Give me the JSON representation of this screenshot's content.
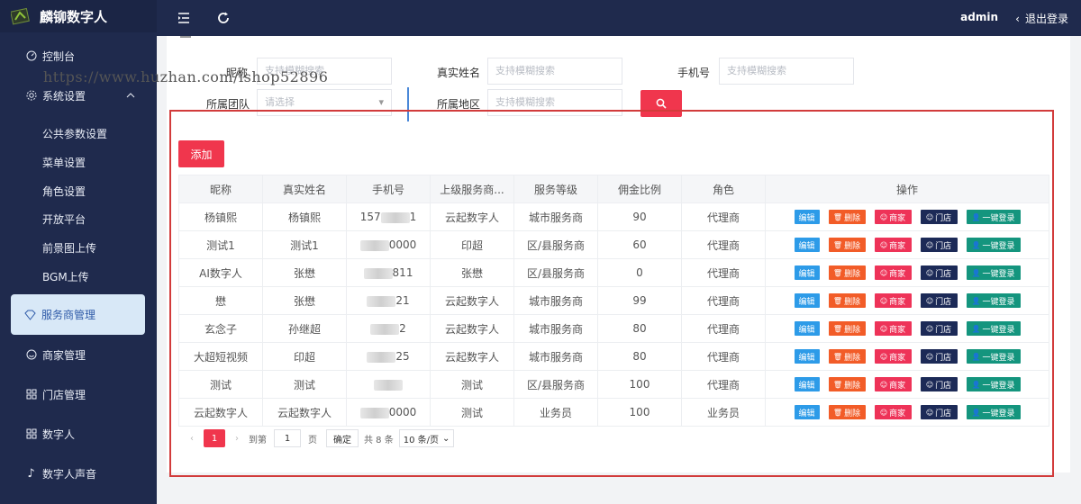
{
  "brand": {
    "name": "麟铆数字人"
  },
  "sidebar": {
    "items": [
      {
        "label": "控制台",
        "icon": "dashboard-icon"
      },
      {
        "label": "系统设置",
        "icon": "gear-icon",
        "expanded": true
      },
      {
        "label": "服务商管理",
        "icon": "diamond-icon",
        "active": true
      },
      {
        "label": "商家管理",
        "icon": "smile-icon"
      },
      {
        "label": "门店管理",
        "icon": "grid-icon"
      },
      {
        "label": "数字人",
        "icon": "grid-icon"
      },
      {
        "label": "数字人声音",
        "icon": "music-note-icon"
      }
    ],
    "subitems": [
      "公共参数设置",
      "菜单设置",
      "角色设置",
      "开放平台",
      "前景图上传",
      "BGM上传"
    ]
  },
  "topbar": {
    "user": "admin",
    "logout": "退出登录"
  },
  "watermark": "https://www.huzhan.com/ishop52896",
  "filters": {
    "nickname": {
      "label": "昵称",
      "placeholder": "支持模糊搜索"
    },
    "realname": {
      "label": "真实姓名",
      "placeholder": "支持模糊搜索"
    },
    "phone": {
      "label": "手机号",
      "placeholder": "支持模糊搜索"
    },
    "team": {
      "label": "所属团队",
      "placeholder": "请选择"
    },
    "region": {
      "label": "所属地区",
      "placeholder": "支持模糊搜索"
    }
  },
  "toolbar": {
    "add": "添加"
  },
  "table": {
    "headers": [
      "昵称",
      "真实姓名",
      "手机号",
      "上级服务商...",
      "服务等级",
      "佣金比例",
      "角色",
      "操作"
    ],
    "rows": [
      {
        "nick": "杨镇熙",
        "real": "杨镇熙",
        "phone_a": "157",
        "phone_b": "1",
        "parent": "云起数字人",
        "level": "城市服务商",
        "rate": "90",
        "role": "代理商"
      },
      {
        "nick": "测试1",
        "real": "测试1",
        "phone_a": "",
        "phone_b": "0000",
        "parent": "印超",
        "level": "区/县服务商",
        "rate": "60",
        "role": "代理商"
      },
      {
        "nick": "AI数字人",
        "real": "张懋",
        "phone_a": "",
        "phone_b": "811",
        "parent": "张懋",
        "level": "区/县服务商",
        "rate": "0",
        "role": "代理商"
      },
      {
        "nick": "懋",
        "real": "张懋",
        "phone_a": "",
        "phone_b": "21",
        "parent": "云起数字人",
        "level": "城市服务商",
        "rate": "99",
        "role": "代理商"
      },
      {
        "nick": "玄念子",
        "real": "孙继超",
        "phone_a": "",
        "phone_b": "2",
        "parent": "云起数字人",
        "level": "城市服务商",
        "rate": "80",
        "role": "代理商"
      },
      {
        "nick": "大超短视频",
        "real": "印超",
        "phone_a": "",
        "phone_b": "25",
        "parent": "云起数字人",
        "level": "城市服务商",
        "rate": "80",
        "role": "代理商"
      },
      {
        "nick": "测试",
        "real": "测试",
        "phone_a": "",
        "phone_b": "",
        "parent": "测试",
        "level": "区/县服务商",
        "rate": "100",
        "role": "代理商"
      },
      {
        "nick": "云起数字人",
        "real": "云起数字人",
        "phone_a": "",
        "phone_b": "0000",
        "parent": "测试",
        "level": "业务员",
        "rate": "100",
        "role": "业务员"
      }
    ],
    "actions": {
      "edit": "编辑",
      "delete": "删除",
      "merchant": "商家",
      "store": "门店",
      "login": "一键登录"
    }
  },
  "pager": {
    "current": "1",
    "goto": "到第",
    "page_input": "1",
    "page_unit": "页",
    "confirm": "确定",
    "total": "共 8 条",
    "page_size": "10 条/页"
  },
  "colors": {
    "sidebar_bg": "#1f2a4d",
    "primary_red": "#f0364d",
    "edit_blue": "#2d9be8",
    "delete_orange": "#f25c28",
    "merchant_pink": "#ee3358",
    "store_navy": "#1c2a57",
    "login_teal": "#14957e"
  }
}
